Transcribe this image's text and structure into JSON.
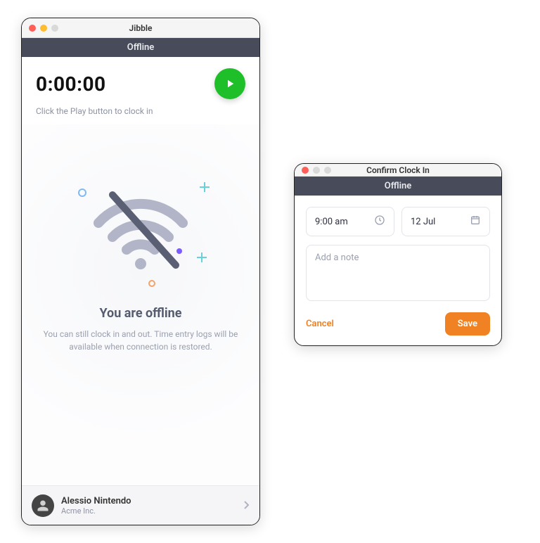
{
  "colors": {
    "traffic_red": "#ff5f57",
    "traffic_yellow": "#febc2e",
    "traffic_green": "#28c840",
    "traffic_dim": "#d9d9d9",
    "accent": "#f08224",
    "play": "#1fbf2a"
  },
  "main_window": {
    "title": "Jibble",
    "banner": "Offline",
    "timer": "0:00:00",
    "hint": "Click the Play button to clock in",
    "empty_title": "You are offline",
    "empty_sub": "You can still clock in and out. Time entry logs will be available when connection is restored.",
    "user": {
      "name": "Alessio Nintendo",
      "company": "Acme Inc."
    }
  },
  "confirm_window": {
    "title": "Confirm Clock In",
    "banner": "Offline",
    "time_value": "9:00 am",
    "date_value": "12 Jul",
    "note_placeholder": "Add a note",
    "cancel": "Cancel",
    "save": "Save"
  }
}
